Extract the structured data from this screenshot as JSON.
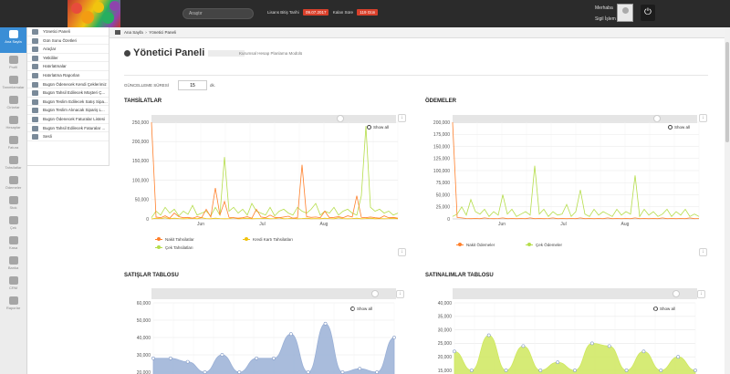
{
  "header": {
    "search_placeholder": "Araştır",
    "license_label": "Lisans Bitiş Tarihi",
    "license_date": "09.07.2017",
    "remaining_label": "Kalan Süre",
    "remaining_value": "119 Gün",
    "user_name": "Merhaba",
    "user_role": "Sigil İşlem"
  },
  "left_nav": [
    {
      "label": "Ana Sayfa",
      "icon": "home-icon",
      "active": true
    },
    {
      "label": "Profil",
      "icon": "user-icon"
    },
    {
      "label": "Tanımlamalar",
      "icon": "gears-icon"
    },
    {
      "label": "Cirlarlar",
      "icon": "refresh-icon"
    },
    {
      "label": "Hesaplar",
      "icon": "users-icon"
    },
    {
      "label": "Fatura",
      "icon": "invoice-icon"
    },
    {
      "label": "Tahsilatlar",
      "icon": "arrow-down-icon"
    },
    {
      "label": "Ödemeler",
      "icon": "arrow-up-icon"
    },
    {
      "label": "Stok",
      "icon": "box-icon"
    },
    {
      "label": "Çek",
      "icon": "check-icon"
    },
    {
      "label": "Kasa",
      "icon": "lock-icon"
    },
    {
      "label": "Banka",
      "icon": "bank-icon"
    },
    {
      "label": "CRM",
      "icon": "crm-icon"
    },
    {
      "label": "Raporlar",
      "icon": "reports-icon"
    }
  ],
  "submenu": [
    {
      "label": "Yönetici Paneli",
      "icon": "panel-icon"
    },
    {
      "label": "Gün Sonu Özetleri",
      "icon": "calendar-icon"
    },
    {
      "label": "Araçlar",
      "icon": "tools-icon"
    },
    {
      "label": "Yetkililer",
      "icon": "people-icon"
    },
    {
      "label": "Hatırlatmalar",
      "icon": "bell-icon"
    },
    {
      "label": "Hatırlatma Raporları",
      "icon": "report-icon"
    },
    {
      "label": "Bugün Ödenecek Kendi Çeklerimiz",
      "icon": "cheque-icon"
    },
    {
      "label": "Bugün Tahsil Edilecek Müşteri Ç...",
      "icon": "cheque-icon"
    },
    {
      "label": "Bugün Teslim Edilecek Satış Sipa...",
      "icon": "order-icon"
    },
    {
      "label": "Bugün Teslim Alınacak Sipariş L...",
      "icon": "order-icon"
    },
    {
      "label": "Bugün Ödenecek Faturalar Listesi",
      "icon": "invoice-icon"
    },
    {
      "label": "Bugün Tahsil Edilecek Faturalar ...",
      "icon": "invoice-icon"
    },
    {
      "label": "Sesli",
      "icon": "sound-icon"
    }
  ],
  "breadcrumb": {
    "home": "Ana Sayfa",
    "current": "Yönetici Paneli"
  },
  "page": {
    "title": "Yönetici Paneli",
    "subtitle": "Kurumsal Hesap Planlama Modülü",
    "refresh_label": "GÜNCELLEME SÜRESİ",
    "refresh_value": "15",
    "refresh_unit": "dk."
  },
  "show_all": "Show all",
  "sections": {
    "collections": "TAHSİLATLAR",
    "payments": "ÖDEMELER",
    "sales": "SATIŞLAR TABLOSU",
    "purchases": "SATINALIMLAR TABLOSU"
  },
  "colors": {
    "accent": "#3a8ed6",
    "orange": "#ff7f2a",
    "yellow": "#f0c30f",
    "green": "#b5dd4a",
    "blue_area": "#9ab0d6",
    "lime_area": "#cfe85e"
  },
  "chart_data": [
    {
      "type": "line",
      "title": "TAHSİLATLAR",
      "x_ticks": [
        "Jun",
        "Jul",
        "Aug"
      ],
      "ylim": [
        0,
        250000
      ],
      "y_ticks": [
        "0",
        "50,000",
        "100,000",
        "150,000",
        "200,000",
        "250,000"
      ],
      "series": [
        {
          "name": "Nakit Tahsilatlar",
          "color": "#ff7f2a",
          "values": [
            250000,
            5000,
            3000,
            8000,
            2000,
            15000,
            6000,
            3000,
            4000,
            2000,
            6000,
            3000,
            25000,
            5000,
            80000,
            10000,
            45000,
            4000,
            3000,
            2000,
            3000,
            6000,
            2000,
            25000,
            5000,
            3000,
            10000,
            4000,
            3000,
            5000,
            7000,
            2000,
            3000,
            140000,
            6000,
            4000,
            5000,
            3000,
            20000,
            3000,
            4000,
            6000,
            3000,
            8000,
            5000,
            60000,
            4000,
            3000,
            5000,
            3000,
            2000,
            8000,
            3000,
            4000,
            2000
          ]
        },
        {
          "name": "Kredi Kartı Tahsilatları",
          "color": "#f0c30f",
          "values": [
            0,
            2000,
            1000,
            3000,
            500,
            2000,
            1000,
            500,
            1000,
            2000,
            500,
            3000,
            1000,
            500,
            2000,
            1000,
            500,
            1000,
            3000,
            500,
            1000,
            2000,
            500,
            1000,
            1000,
            2000,
            500,
            1000,
            3000,
            500,
            1000,
            2000,
            500,
            1000,
            2000,
            500,
            1000,
            500,
            2000,
            1000,
            500,
            3000,
            1000,
            500,
            1000,
            2000,
            500,
            1000,
            2000,
            500,
            1000,
            500,
            1000,
            2000,
            500
          ]
        },
        {
          "name": "Çek Tahsilatları",
          "color": "#b5dd4a",
          "values": [
            3000,
            20000,
            10000,
            30000,
            15000,
            25000,
            8000,
            20000,
            12000,
            35000,
            10000,
            15000,
            20000,
            8000,
            30000,
            10000,
            160000,
            20000,
            30000,
            15000,
            25000,
            10000,
            40000,
            20000,
            15000,
            10000,
            30000,
            8000,
            20000,
            25000,
            15000,
            10000,
            30000,
            20000,
            15000,
            25000,
            40000,
            10000,
            20000,
            15000,
            30000,
            10000,
            20000,
            25000,
            15000,
            10000,
            60000,
            240000,
            30000,
            20000,
            25000,
            15000,
            20000,
            10000,
            15000
          ]
        }
      ]
    },
    {
      "type": "line",
      "title": "ÖDEMELER",
      "x_ticks": [
        "Jun",
        "Jul",
        "Aug"
      ],
      "ylim": [
        0,
        200000
      ],
      "y_ticks": [
        "0",
        "25,000",
        "50,000",
        "75,000",
        "100,000",
        "125,000",
        "150,000",
        "175,000",
        "200,000"
      ],
      "series": [
        {
          "name": "Nakit Ödemeler",
          "color": "#ff7f2a",
          "values": [
            200000,
            3000,
            2000,
            1000,
            500,
            1000,
            500,
            2000,
            1000,
            500,
            1000,
            2000,
            500,
            1000,
            500,
            1000,
            500,
            2000,
            500,
            1000,
            500,
            1000,
            2000,
            500,
            1000,
            500,
            1000,
            500,
            2000,
            500,
            1000,
            500,
            1000,
            500,
            2000,
            500,
            1000,
            500,
            1000,
            500,
            2000,
            500,
            1000,
            500,
            1000,
            500,
            2000,
            500,
            1000,
            500,
            1000,
            500,
            2000,
            500,
            1000
          ]
        },
        {
          "name": "Çek Ödemeler",
          "color": "#b5dd4a",
          "values": [
            5000,
            10000,
            25000,
            8000,
            40000,
            15000,
            10000,
            20000,
            5000,
            15000,
            8000,
            50000,
            10000,
            20000,
            5000,
            10000,
            15000,
            8000,
            110000,
            10000,
            20000,
            5000,
            15000,
            8000,
            10000,
            30000,
            5000,
            15000,
            60000,
            10000,
            5000,
            20000,
            8000,
            15000,
            10000,
            5000,
            20000,
            8000,
            15000,
            10000,
            90000,
            5000,
            20000,
            8000,
            15000,
            5000,
            10000,
            20000,
            5000,
            15000,
            8000,
            20000,
            5000,
            10000,
            5000
          ]
        }
      ]
    },
    {
      "type": "area",
      "title": "SATIŞLAR TABLOSU",
      "ylim": [
        20000,
        60000
      ],
      "y_ticks": [
        "20,000",
        "30,000",
        "40,000",
        "50,000",
        "60,000"
      ],
      "series": [
        {
          "name": "",
          "color": "#9ab0d6",
          "values": [
            28000,
            28000,
            26000,
            20000,
            30000,
            20000,
            28000,
            28000,
            42000,
            20000,
            48000,
            20000,
            22000,
            20000,
            40000
          ]
        }
      ]
    },
    {
      "type": "area",
      "title": "SATINALIMLAR TABLOSU",
      "ylim": [
        15000,
        40000
      ],
      "y_ticks": [
        "15,000",
        "20,000",
        "25,000",
        "30,000",
        "35,000",
        "40,000"
      ],
      "series": [
        {
          "name": "",
          "color": "#cfe85e",
          "values": [
            22000,
            15000,
            28000,
            15000,
            24000,
            15000,
            18000,
            15000,
            25000,
            24000,
            15000,
            22000,
            15000,
            20000,
            15000
          ]
        }
      ]
    }
  ]
}
